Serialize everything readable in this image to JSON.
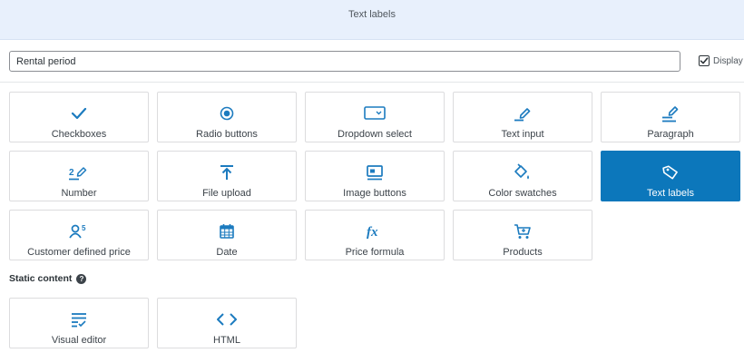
{
  "header": {
    "title": "Text labels"
  },
  "field": {
    "name_value": "Rental period",
    "display_label": "Display",
    "display_checked": true
  },
  "field_types": [
    {
      "label": "Checkboxes",
      "icon": "checkmark-icon"
    },
    {
      "label": "Radio buttons",
      "icon": "radio-icon"
    },
    {
      "label": "Dropdown select",
      "icon": "dropdown-icon"
    },
    {
      "label": "Text input",
      "icon": "text-input-icon"
    },
    {
      "label": "Paragraph",
      "icon": "paragraph-icon"
    },
    {
      "label": "Number",
      "icon": "number-icon"
    },
    {
      "label": "File upload",
      "icon": "upload-icon"
    },
    {
      "label": "Image buttons",
      "icon": "image-buttons-icon"
    },
    {
      "label": "Color swatches",
      "icon": "paint-bucket-icon"
    },
    {
      "label": "Text labels",
      "icon": "tag-icon",
      "selected": true
    },
    {
      "label": "Customer defined price",
      "icon": "customer-price-icon"
    },
    {
      "label": "Date",
      "icon": "calendar-icon"
    },
    {
      "label": "Price formula",
      "icon": "fx-icon"
    },
    {
      "label": "Products",
      "icon": "cart-icon"
    }
  ],
  "static_content": {
    "heading": "Static content",
    "help_glyph": "?",
    "items": [
      {
        "label": "Visual editor",
        "icon": "visual-editor-icon"
      },
      {
        "label": "HTML",
        "icon": "code-icon"
      }
    ]
  },
  "colors": {
    "accent": "#0c77bb",
    "icon_blue": "#1c7bbf",
    "header_bg": "#e8f0fc"
  }
}
